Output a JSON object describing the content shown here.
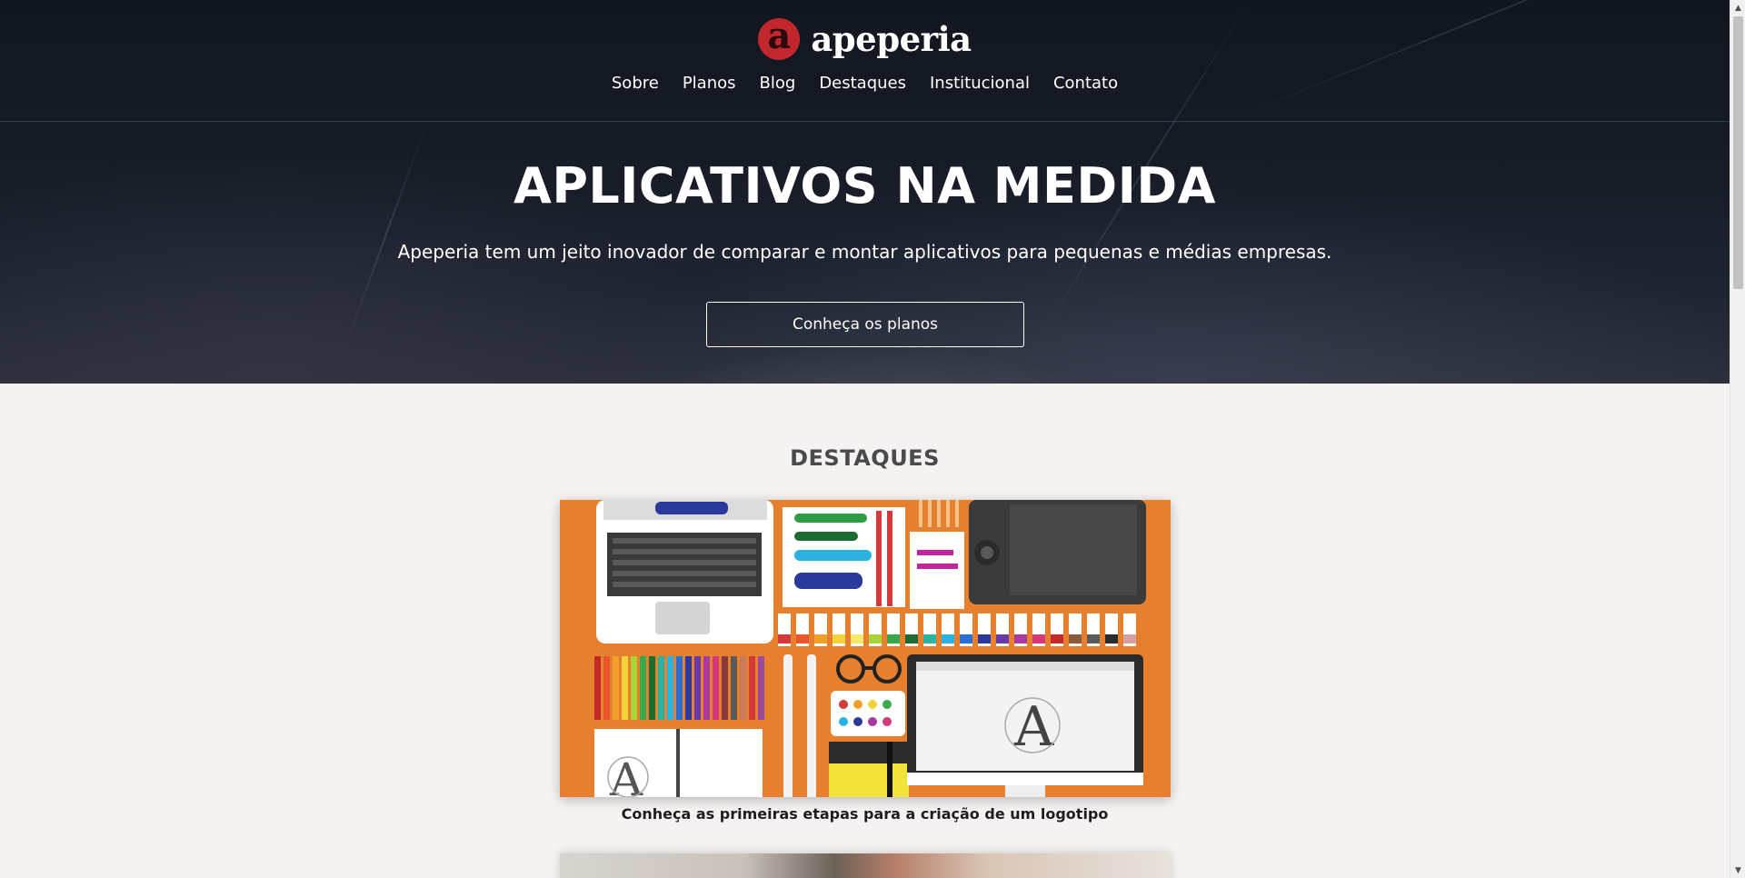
{
  "brand": {
    "logo_letter": "a",
    "name": "apeperia",
    "accent": "#c1272d"
  },
  "nav": {
    "items": [
      {
        "label": "Sobre"
      },
      {
        "label": "Planos"
      },
      {
        "label": "Blog"
      },
      {
        "label": "Destaques"
      },
      {
        "label": "Institucional"
      },
      {
        "label": "Contato"
      }
    ]
  },
  "hero": {
    "title": "APLICATIVOS NA MEDIDA",
    "subtitle": "Apeperia tem um jeito inovador de comparar e montar aplicativos para pequenas e médias empresas.",
    "cta_label": "Conheça os planos"
  },
  "highlights": {
    "title": "DESTAQUES",
    "cards": [
      {
        "caption": "Conheça as primeiras etapas para a criação de um logotipo",
        "image_icon": "designer-desk-illustration"
      },
      {
        "caption": "",
        "image_icon": "person-photo"
      }
    ]
  },
  "scrollbar": {
    "up_icon": "▲",
    "down_icon": "▼"
  }
}
